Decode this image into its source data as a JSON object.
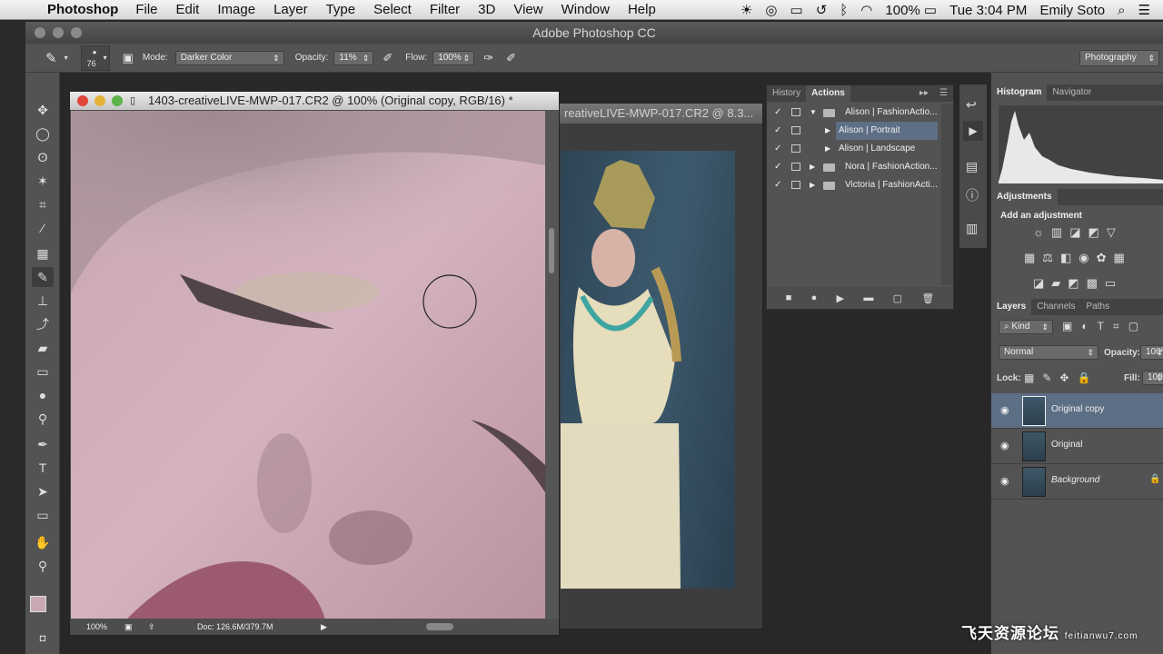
{
  "menubar": {
    "app_name": "Photoshop",
    "items": [
      "File",
      "Edit",
      "Image",
      "Layer",
      "Type",
      "Select",
      "Filter",
      "3D",
      "View",
      "Window",
      "Help"
    ],
    "battery": "100%",
    "clock": "Tue 3:04 PM",
    "user": "Emily Soto"
  },
  "window": {
    "title": "Adobe Photoshop CC"
  },
  "options": {
    "brush_size": "76",
    "mode_label": "Mode:",
    "mode_value": "Darker Color",
    "opacity_label": "Opacity:",
    "opacity_value": "11%",
    "flow_label": "Flow:",
    "flow_value": "100%",
    "workspace": "Photography"
  },
  "doc_front": {
    "title": "1403-creativeLIVE-MWP-017.CR2 @ 100% (Original copy, RGB/16) *",
    "zoom": "100%",
    "doc_info": "Doc: 126.6M/379.7M"
  },
  "doc_back": {
    "title": "reativeLIVE-MWP-017.CR2 @ 8.3..."
  },
  "actions_panel": {
    "tabs": [
      "History",
      "Actions"
    ],
    "rows": [
      {
        "label": "Alison | FashionActio...",
        "type": "folder",
        "expanded": true
      },
      {
        "label": "Alison | Portrait",
        "type": "action",
        "selected": true
      },
      {
        "label": "Alison | Landscape",
        "type": "action"
      },
      {
        "label": "Nora | FashionAction...",
        "type": "folder"
      },
      {
        "label": "Victoria | FashionActi...",
        "type": "folder"
      }
    ]
  },
  "histogram": {
    "tabs": [
      "Histogram",
      "Navigator"
    ]
  },
  "adjustments": {
    "tab": "Adjustments",
    "prompt": "Add an adjustment"
  },
  "layers_panel": {
    "tabs": [
      "Layers",
      "Channels",
      "Paths"
    ],
    "filter_label": "Kind",
    "blend_mode": "Normal",
    "opacity_label": "Opacity:",
    "opacity_value": "100%",
    "lock_label": "Lock:",
    "fill_label": "Fill:",
    "fill_value": "100%",
    "layers": [
      {
        "name": "Original copy",
        "selected": true
      },
      {
        "name": "Original"
      },
      {
        "name": "Background",
        "locked": true
      }
    ]
  },
  "watermark": {
    "text": "飞天资源论坛",
    "sub": "feitianwu7.com"
  },
  "colors": {
    "panel": "#535353",
    "selection": "#5d6f85",
    "workspace": "#282828"
  }
}
